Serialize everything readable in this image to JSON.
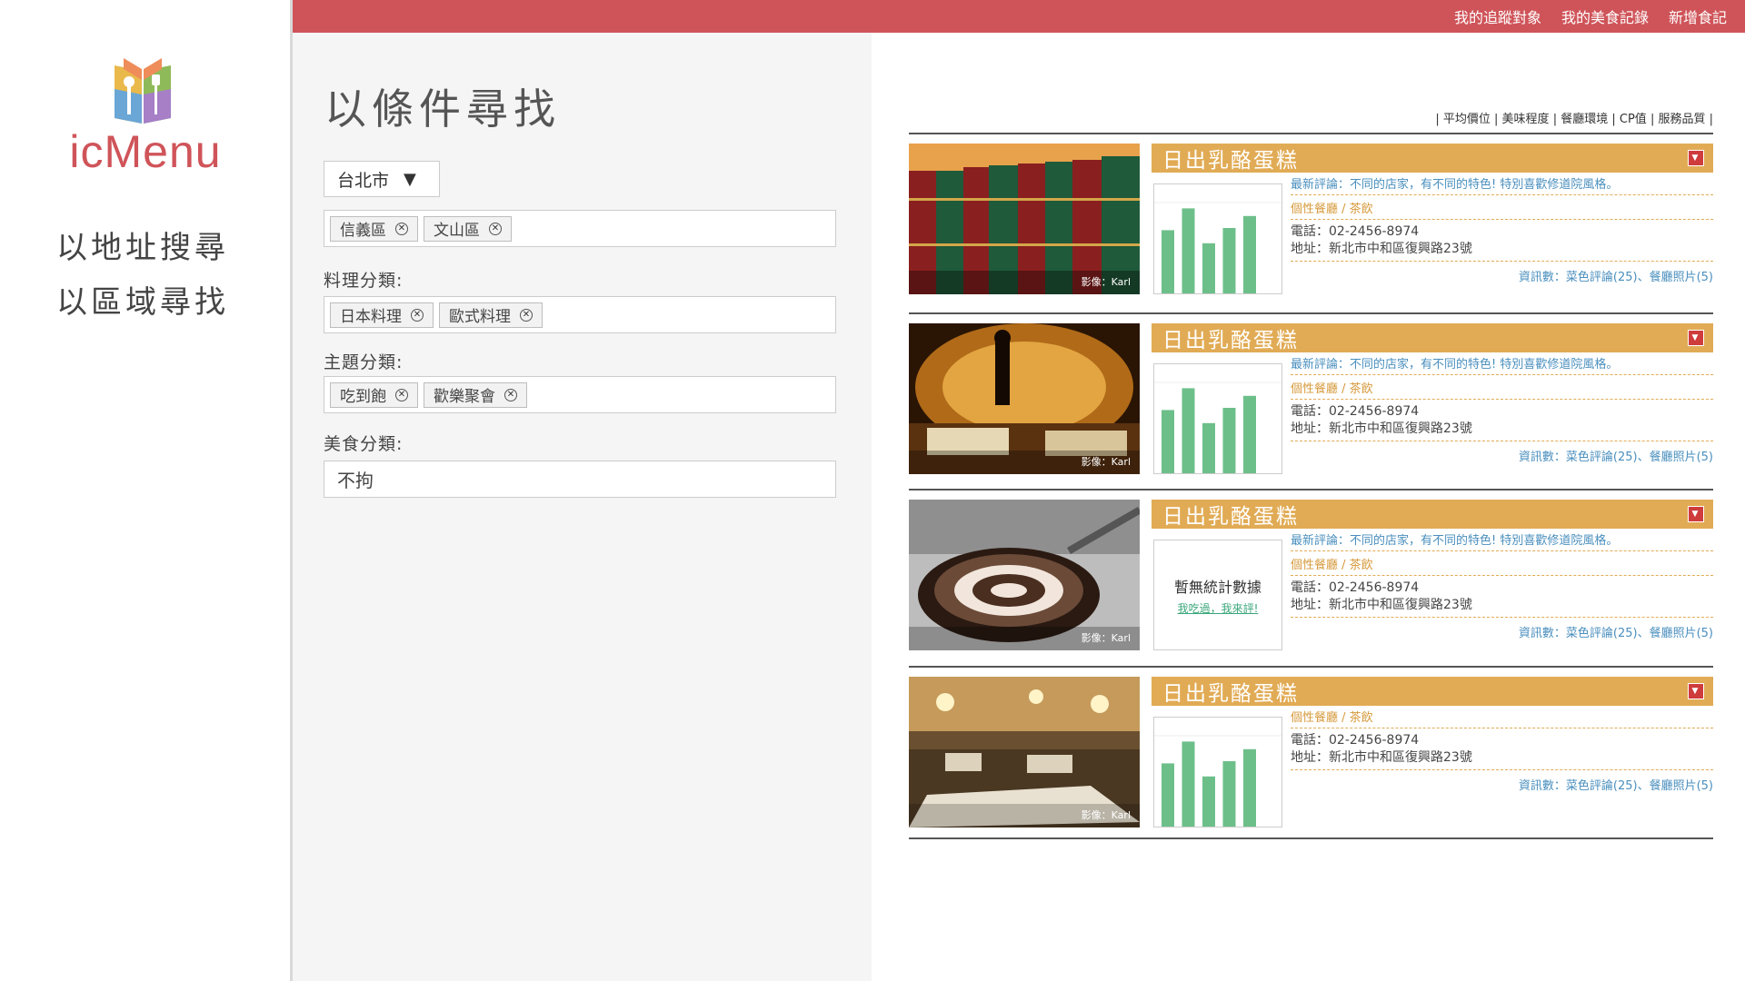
{
  "topnav": [
    "我的追蹤對象",
    "我的美食記錄",
    "新增食記"
  ],
  "logo": {
    "text": "icMenu"
  },
  "sidebar": {
    "items": [
      "以地址搜尋",
      "以區域尋找"
    ]
  },
  "filter": {
    "title": "以條件尋找",
    "city": "台北市",
    "district_tags": [
      "信義區",
      "文山區"
    ],
    "cuisine_label": "料理分類:",
    "cuisine_tags": [
      "日本料理",
      "歐式料理"
    ],
    "theme_label": "主題分類:",
    "theme_tags": [
      "吃到飽",
      "歡樂聚會"
    ],
    "food_label": "美食分類:",
    "food_value": "不拘"
  },
  "sort_options": [
    "平均價位",
    "美味程度",
    "餐廳環境",
    "CP值",
    "服務品質"
  ],
  "results": [
    {
      "title": "日出乳酪蛋糕",
      "photo_credit": "影像：Karl",
      "review": "最新評論：不同的店家，有不同的特色! 特別喜歡修道院風格。",
      "category": "個性餐廳 / 茶飲",
      "phone": "電話：02-2456-8974",
      "address": "地址：新北市中和區復興路23號",
      "links": "資訊數：菜色評論(25)、餐廳照片(5)",
      "chart": [
        0.58,
        0.78,
        0.46,
        0.6,
        0.71
      ],
      "has_stats": true
    },
    {
      "title": "日出乳酪蛋糕",
      "photo_credit": "影像：Karl",
      "review": "最新評論：不同的店家，有不同的特色! 特別喜歡修道院風格。",
      "category": "個性餐廳 / 茶飲",
      "phone": "電話：02-2456-8974",
      "address": "地址：新北市中和區復興路23號",
      "links": "資訊數：菜色評論(25)、餐廳照片(5)",
      "chart": [
        0.58,
        0.78,
        0.46,
        0.6,
        0.71
      ],
      "has_stats": true
    },
    {
      "title": "日出乳酪蛋糕",
      "photo_credit": "影像：Karl",
      "review": "最新評論：不同的店家，有不同的特色! 特別喜歡修道院風格。",
      "category": "個性餐廳 / 茶飲",
      "phone": "電話：02-2456-8974",
      "address": "地址：新北市中和區復興路23號",
      "links": "資訊數：菜色評論(25)、餐廳照片(5)",
      "no_stats_text": "暫無統計數據",
      "no_stats_link": "我吃過，我來評!",
      "has_stats": false
    },
    {
      "title": "日出乳酪蛋糕",
      "photo_credit": "影像：Karl",
      "category": "個性餐廳 / 茶飲",
      "phone": "電話：02-2456-8974",
      "address": "地址：新北市中和區復興路23號",
      "links": "資訊數：菜色評論(25)、餐廳照片(5)",
      "chart": [
        0.58,
        0.78,
        0.46,
        0.6,
        0.71
      ],
      "has_stats": true
    }
  ],
  "colors": {
    "brand": "#cf5459",
    "accent": "#e1ab55",
    "bar": "#6dbf8a",
    "link": "#4a8fbe"
  }
}
